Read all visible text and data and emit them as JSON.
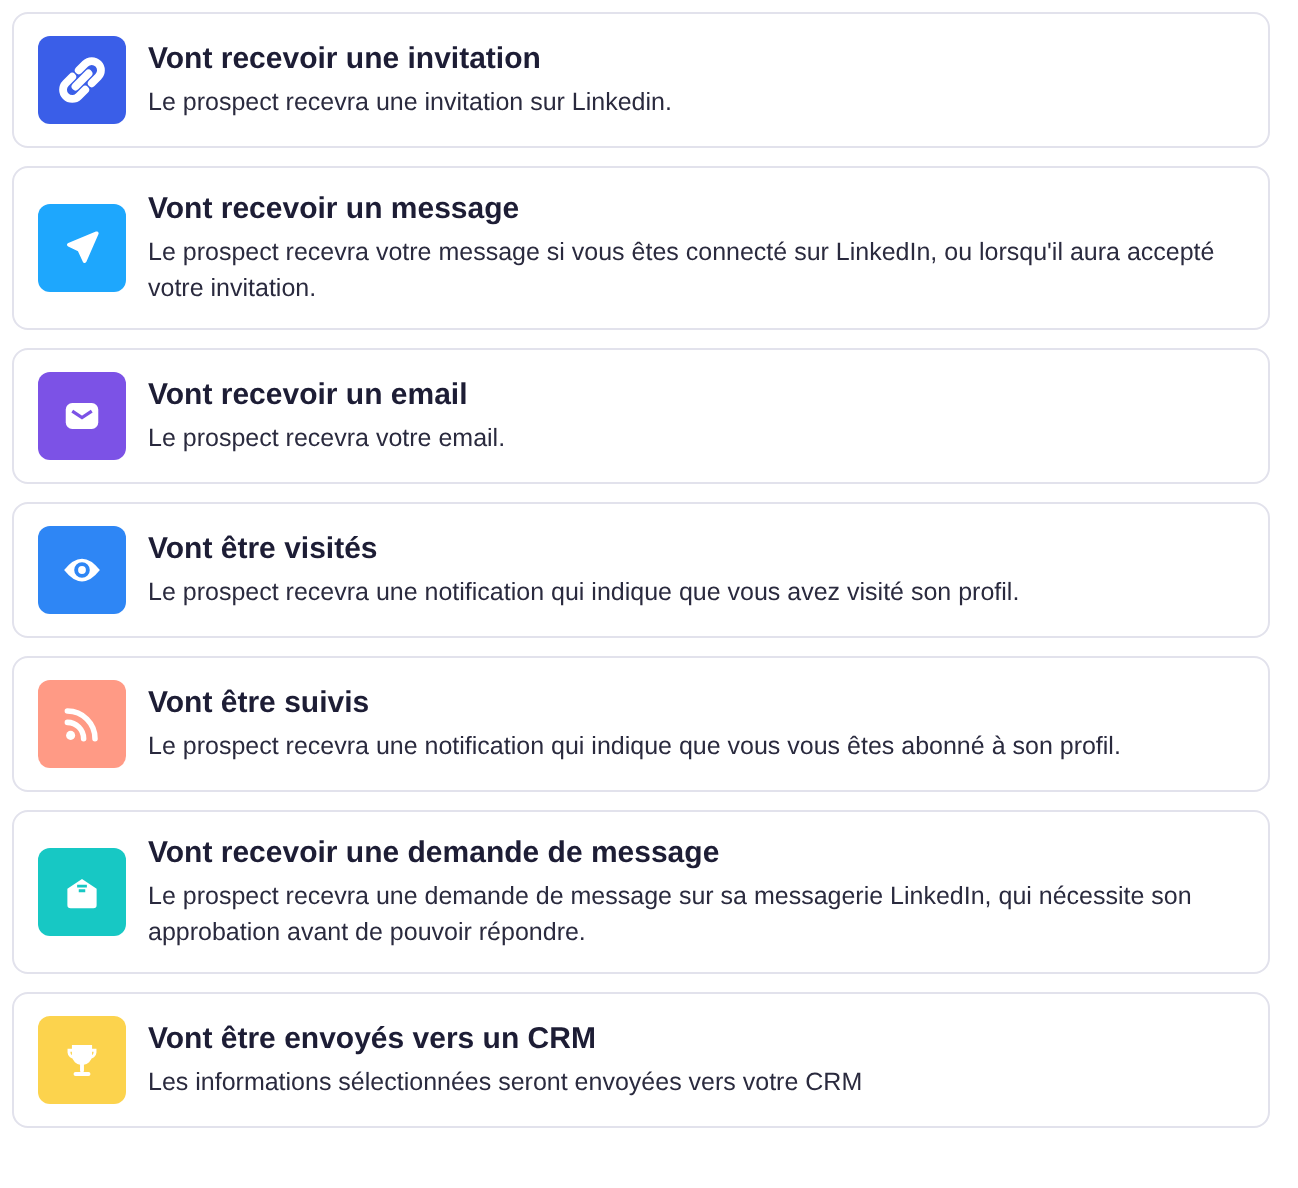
{
  "actions": [
    {
      "kind": "link",
      "color": "#3a5ee8",
      "title": "Vont recevoir une invitation",
      "description": "Le prospect recevra une invitation sur Linkedin."
    },
    {
      "kind": "send",
      "color": "#1ea7fd",
      "title": "Vont recevoir un message",
      "description": "Le prospect recevra votre message si vous êtes connecté sur LinkedIn, ou lorsqu'il aura accepté votre invitation."
    },
    {
      "kind": "mail",
      "color": "#7c52e6",
      "title": "Vont recevoir un email",
      "description": "Le prospect recevra votre email."
    },
    {
      "kind": "eye",
      "color": "#2e86f5",
      "title": "Vont être visités",
      "description": "Le prospect recevra une notification qui indique que vous avez visité son profil."
    },
    {
      "kind": "rss",
      "color": "#ff9a85",
      "title": "Vont être suivis",
      "description": "Le prospect recevra une notification qui indique que vous vous êtes abonné à son profil."
    },
    {
      "kind": "inbox",
      "color": "#17c8c4",
      "title": "Vont recevoir une demande de message",
      "description": "Le prospect recevra une demande de message sur sa messagerie LinkedIn, qui nécessite son approbation avant de pouvoir répondre."
    },
    {
      "kind": "trophy",
      "color": "#fcd34d",
      "title": "Vont être envoyés vers un CRM",
      "description": "Les informations sélectionnées seront envoyées vers votre CRM"
    }
  ]
}
